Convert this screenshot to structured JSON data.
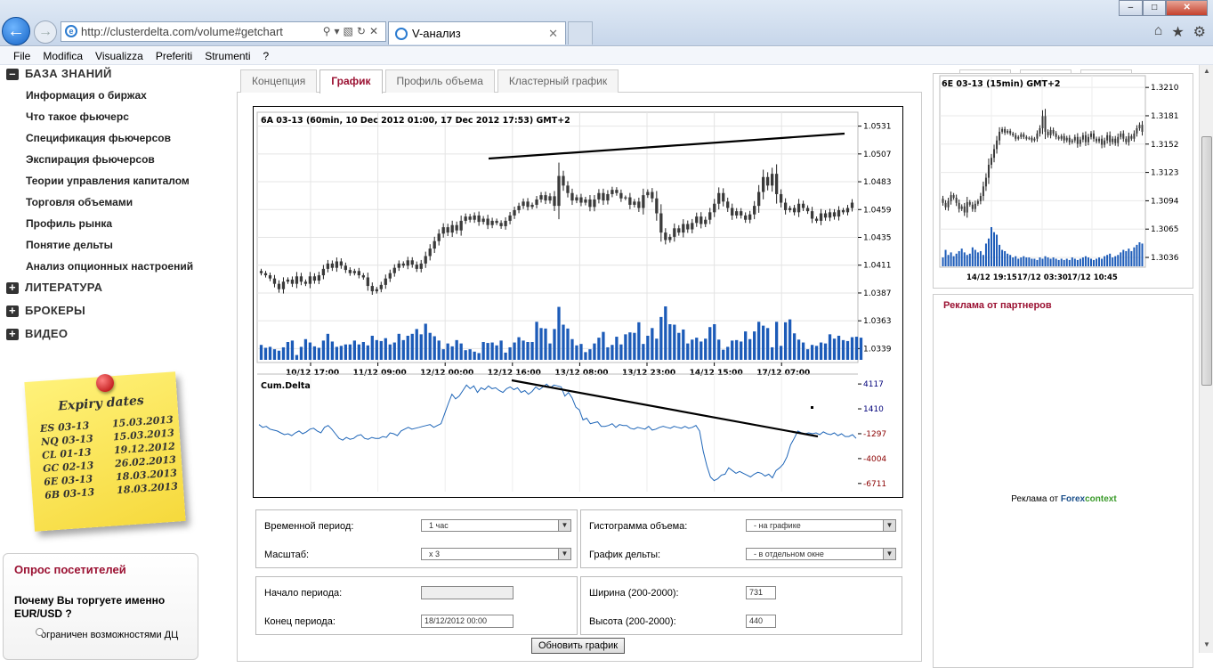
{
  "browser": {
    "url": "http://clusterdelta.com/volume#getchart",
    "tab_title": "V-анализ",
    "menu": [
      "File",
      "Modifica",
      "Visualizza",
      "Preferiti",
      "Strumenti",
      "?"
    ]
  },
  "sidebar": {
    "knowledge_title": "БАЗА ЗНАНИЙ",
    "items": [
      {
        "label": "Информация о биржах"
      },
      {
        "label": "Что такое фьючерс"
      },
      {
        "label": "Спецификация фьючерсов"
      },
      {
        "label": "Экспирация фьючерсов"
      },
      {
        "label": "Теории управления капиталом"
      },
      {
        "label": "Торговля объемами"
      },
      {
        "label": "Профиль рынка"
      },
      {
        "label": "Понятие дельты"
      },
      {
        "label": "Анализ опционных настроений"
      }
    ],
    "sections": [
      {
        "label": "ЛИТЕРАТУРА"
      },
      {
        "label": "БРОКЕРЫ"
      },
      {
        "label": "ВИДЕО"
      }
    ]
  },
  "expiry": {
    "title": "Expiry dates",
    "rows": [
      {
        "symbol": "ES 03-13",
        "date": "15.03.2013"
      },
      {
        "symbol": "NQ 03-13",
        "date": "15.03.2013"
      },
      {
        "symbol": "CL 01-13",
        "date": "19.12.2012"
      },
      {
        "symbol": "GC 02-13",
        "date": "26.02.2013"
      },
      {
        "symbol": "6E 03-13",
        "date": "18.03.2013"
      },
      {
        "symbol": "6B 03-13",
        "date": "18.03.2013"
      }
    ]
  },
  "poll": {
    "title": "Опрос посетителей",
    "question": "Почему Вы торгуете именно EUR/USD ?",
    "option": "ограничен возможностями ДЦ"
  },
  "chart_tabs": [
    {
      "label": "Концепция",
      "active": false
    },
    {
      "label": "График",
      "active": true
    },
    {
      "label": "Профиль объема",
      "active": false
    },
    {
      "label": "Кластерный график",
      "active": false
    }
  ],
  "form": {
    "period_label": "Временной период:",
    "period_value": "1 час",
    "scale_label": "Масштаб:",
    "scale_value": "x 3",
    "vol_hist_label": "Гистограмма объема:",
    "vol_hist_value": "- на графике",
    "delta_label": "График дельты:",
    "delta_value": "- в отдельном окне",
    "start_label": "Начало периода:",
    "start_value": "",
    "end_label": "Конец периода:",
    "end_value": "18/12/2012 00:00",
    "width_label": "Ширина (200-2000):",
    "width_value": "731",
    "height_label": "Высота (200-2000):",
    "height_value": "440",
    "update_button": "Обновить график"
  },
  "ads": {
    "title": "Реклама от партнеров",
    "prefix": "Реклама от",
    "brand_a": "Forex",
    "brand_b": "context"
  },
  "chart_data": [
    {
      "type": "candlestick",
      "title": "6A 03-13 (60min, 10 Dec 2012 01:00, 17 Dec 2012 17:53) GMT+2",
      "y_ticks": [
        "1.0531",
        "1.0507",
        "1.0483",
        "1.0459",
        "1.0435",
        "1.0411",
        "1.0387",
        "1.0363",
        "1.0339"
      ],
      "x_ticks": [
        "10/12 17:00",
        "11/12 09:00",
        "12/12 00:00",
        "12/12 16:00",
        "13/12 08:00",
        "13/12 23:00",
        "14/12 15:00",
        "17/12 07:00"
      ],
      "ylim": [
        1.0327,
        1.0543
      ],
      "close": [
        1.0409,
        1.0407,
        1.0404,
        1.0399,
        1.0394,
        1.0401,
        1.0403,
        1.0399,
        1.0406,
        1.0401,
        1.0399,
        1.0406,
        1.0402,
        1.0407,
        1.0413,
        1.0418,
        1.0414,
        1.042,
        1.0416,
        1.0412,
        1.0409,
        1.0411,
        1.0407,
        1.0405,
        1.0397,
        1.0392,
        1.0394,
        1.0398,
        1.0404,
        1.0409,
        1.0414,
        1.0418,
        1.0416,
        1.0421,
        1.0417,
        1.0413,
        1.0418,
        1.0425,
        1.0432,
        1.0439,
        1.0446,
        1.0452,
        1.0447,
        1.0454,
        1.0449,
        1.0458,
        1.0462,
        1.0459,
        1.0463,
        1.0457,
        1.046,
        1.0454,
        1.0458,
        1.0456,
        1.0453,
        1.0458,
        1.0463,
        1.0468,
        1.0472,
        1.0476,
        1.0471,
        1.0473,
        1.0478,
        1.0482,
        1.0477,
        1.0481,
        1.0472,
        1.05,
        1.0491,
        1.0484,
        1.0477,
        1.048,
        1.0475,
        1.0478,
        1.0471,
        1.0478,
        1.0484,
        1.0477,
        1.0483,
        1.0487,
        1.0484,
        1.0479,
        1.048,
        1.0473,
        1.0476,
        1.047,
        1.0482,
        1.0485,
        1.0479,
        1.0465,
        1.0447,
        1.044,
        1.0443,
        1.0451,
        1.0447,
        1.0455,
        1.045,
        1.0456,
        1.0462,
        1.0455,
        1.0459,
        1.0466,
        1.0474,
        1.0484,
        1.0476,
        1.047,
        1.0463,
        1.0467,
        1.0463,
        1.0459,
        1.0464,
        1.0472,
        1.0485,
        1.0499,
        1.0491,
        1.0502,
        1.0483,
        1.0475,
        1.0468,
        1.047,
        1.0466,
        1.0474,
        1.047,
        1.0467,
        1.046,
        1.0458,
        1.0465,
        1.0461,
        1.0466,
        1.0462,
        1.0468,
        1.0466,
        1.047,
        1.0475
      ],
      "volume": [
        31,
        25,
        27,
        22,
        19,
        26,
        37,
        40,
        10,
        27,
        43,
        36,
        28,
        25,
        40,
        54,
        38,
        27,
        29,
        32,
        32,
        40,
        32,
        37,
        30,
        50,
        41,
        39,
        45,
        32,
        36,
        54,
        41,
        50,
        54,
        64,
        53,
        75,
        56,
        49,
        40,
        22,
        34,
        28,
        41,
        34,
        20,
        22,
        17,
        14,
        37,
        35,
        36,
        30,
        40,
        15,
        26,
        36,
        47,
        40,
        37,
        37,
        79,
        66,
        65,
        34,
        64,
        110,
        73,
        65,
        43,
        30,
        33,
        16,
        22,
        34,
        46,
        58,
        26,
        31,
        48,
        32,
        53,
        57,
        56,
        78,
        33,
        50,
        66,
        44,
        89,
        111,
        74,
        73,
        56,
        63,
        34,
        42,
        46,
        38,
        44,
        68,
        74,
        42,
        21,
        27,
        40,
        41,
        38,
        59,
        43,
        59,
        79,
        71,
        66,
        26,
        79,
        29,
        78,
        84,
        55,
        42,
        36,
        22,
        31,
        29,
        36,
        34,
        53,
        44,
        50,
        41,
        39,
        47,
        48,
        46
      ]
    },
    {
      "type": "line",
      "title": "Cum.Delta",
      "y_ticks": [
        "4117",
        "1410",
        "-1297",
        "-4004",
        "-6711"
      ],
      "ylim": [
        -7600,
        5000
      ],
      "values": [
        -300,
        -600,
        -500,
        -800,
        -900,
        -1000,
        -1200,
        -1400,
        -1300,
        -1500,
        -1200,
        -1000,
        -1300,
        -1100,
        -800,
        -700,
        -1000,
        -1200,
        -600,
        -400,
        -800,
        -1300,
        -1800,
        -2000,
        -1700,
        -1900,
        -1800,
        -1500,
        -1400,
        -1800,
        -1900,
        -1700,
        -1800,
        -1800,
        -1600,
        -1700,
        -1200,
        -1300,
        -1500,
        -1000,
        -800,
        -600,
        -800,
        -700,
        -600,
        -500,
        -400,
        -300,
        -600,
        -400,
        -200,
        900,
        2000,
        3000,
        2500,
        2800,
        3400,
        4000,
        3600,
        3900,
        3200,
        3700,
        3500,
        3900,
        3600,
        3700,
        3400,
        3200,
        3600,
        3800,
        3500,
        3700,
        3200,
        3400,
        3000,
        3300,
        3800,
        3500,
        3800,
        4100,
        3700,
        4000,
        3900,
        3800,
        2800,
        3200,
        2600,
        1600,
        1300,
        200,
        400,
        -200,
        -100,
        0,
        -500,
        -500,
        -400,
        -200,
        -600,
        -300,
        -400,
        -400,
        -700,
        -800,
        -600,
        -700,
        -800,
        -500,
        -900,
        -800,
        -600,
        -500,
        -600,
        -700,
        -500,
        -600,
        -700,
        -500,
        -700,
        -600,
        -400,
        -1000,
        -3200,
        -4800,
        -6000,
        -6400,
        -6200,
        -5800,
        -5700,
        -5000,
        -5300,
        -5600,
        -5400,
        -5600,
        -5800,
        -6000,
        -5700,
        -5500,
        -5600,
        -5900,
        -5700,
        -6100,
        -5300,
        -5000,
        -4600,
        -3800,
        -2500,
        -1800,
        -1000,
        -1200,
        -1300,
        -1200,
        -1300,
        -1200,
        -1400,
        -1100,
        -1300,
        -1400,
        -1200,
        -1500,
        -1300,
        -1600,
        -1600,
        -1400,
        -1800
      ],
      "annotations": [
        "downward trendline drawn over cumulative delta"
      ]
    },
    {
      "type": "candlestick",
      "title": "6E 03-13 (15min) GMT+2",
      "y_ticks": [
        "1.3210",
        "1.3181",
        "1.3152",
        "1.3123",
        "1.3094",
        "1.3065",
        "1.3036"
      ],
      "x_ticks": [
        "14/12 19:15",
        "17/12 03:30",
        "17/12 10:45"
      ],
      "ylim": [
        1.3026,
        1.3222
      ],
      "close": [
        1.3098,
        1.3093,
        1.31,
        1.3107,
        1.3104,
        1.3098,
        1.3091,
        1.3094,
        1.3087,
        1.3099,
        1.3096,
        1.3091,
        1.3097,
        1.31,
        1.3106,
        1.3117,
        1.3127,
        1.3142,
        1.315,
        1.316,
        1.317,
        1.318,
        1.3183,
        1.3179,
        1.3181,
        1.3178,
        1.3176,
        1.3172,
        1.3174,
        1.3177,
        1.3174,
        1.3172,
        1.3173,
        1.317,
        1.3172,
        1.3178,
        1.3184,
        1.3198,
        1.318,
        1.3176,
        1.3182,
        1.3178,
        1.3174,
        1.3172,
        1.3175,
        1.317,
        1.3173,
        1.3168,
        1.317,
        1.3174,
        1.3166,
        1.3171,
        1.3176,
        1.3168,
        1.3174,
        1.3178,
        1.3172,
        1.3169,
        1.3172,
        1.3165,
        1.317,
        1.3176,
        1.3168,
        1.3172,
        1.3167,
        1.3174,
        1.3178,
        1.3172,
        1.3168,
        1.3175,
        1.3172,
        1.3178,
        1.3184,
        1.3188,
        1.318
      ],
      "volume": [
        7,
        13,
        9,
        11,
        8,
        10,
        12,
        14,
        11,
        9,
        10,
        15,
        13,
        11,
        12,
        9,
        18,
        22,
        31,
        27,
        25,
        17,
        13,
        12,
        10,
        9,
        7,
        8,
        6,
        7,
        8,
        7,
        7,
        6,
        6,
        5,
        7,
        6,
        8,
        7,
        6,
        7,
        6,
        5,
        6,
        5,
        6,
        5,
        7,
        6,
        5,
        6,
        7,
        8,
        7,
        6,
        5,
        6,
        7,
        6,
        8,
        9,
        10,
        7,
        8,
        9,
        11,
        13,
        12,
        14,
        12,
        15,
        17,
        19,
        18
      ]
    }
  ]
}
